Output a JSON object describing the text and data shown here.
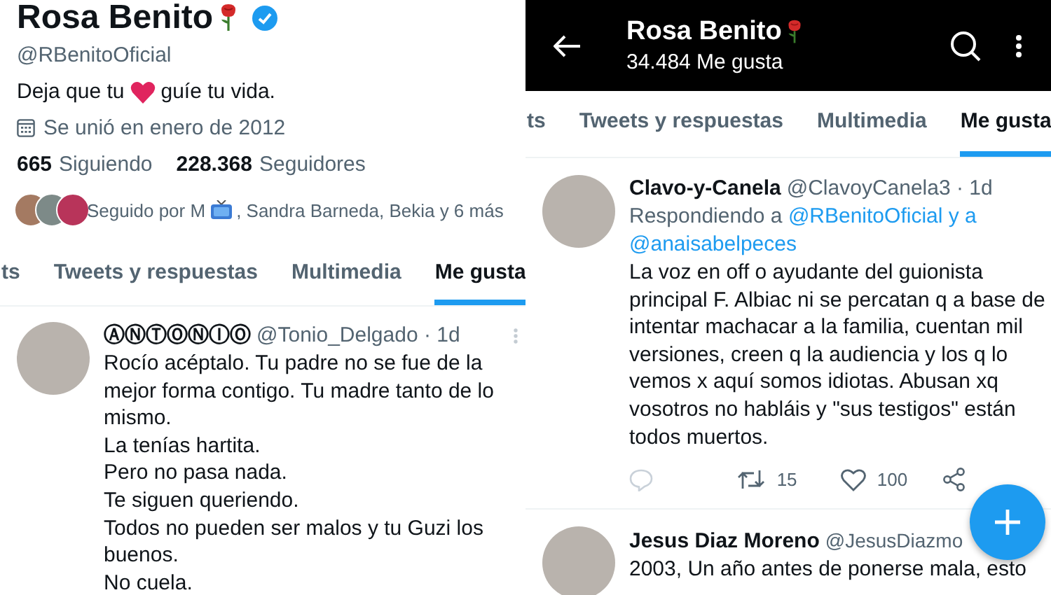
{
  "left_panel": {
    "profile": {
      "name": "Rosa Benito",
      "verified": true,
      "handle": "@RBenitoOficial",
      "bio_before": "Deja que tu",
      "bio_after": "guíe tu vida.",
      "joined": "Se unió en enero de 2012",
      "following_count": "665",
      "following_label": "Siguiendo",
      "followers_count": "228.368",
      "followers_label": "Seguidores",
      "followed_by_before": "Seguido por M",
      "followed_by_after": ", Sandra Barneda, Bekia y 6 más"
    },
    "tabs": [
      {
        "label": "ts",
        "selected": false
      },
      {
        "label": "Tweets y respuestas",
        "selected": false
      },
      {
        "label": "Multimedia",
        "selected": false
      },
      {
        "label": "Me gusta",
        "selected": true
      }
    ],
    "tweets": [
      {
        "author": "ⒶⓃⓉⓄⓃⒾⓄ",
        "meta": "@Tonio_Delgado · 1d",
        "text": "Rocío acéptalo. Tu padre no se fue de la mejor forma contigo. Tu madre tanto de lo mismo.\nLa tenías hartita.\nPero no pasa nada.\nTe siguen queriendo.\nTodos no pueden ser malos y tu Guzi los buenos.\nNo cuela."
      }
    ]
  },
  "right_panel": {
    "header": {
      "title": "Rosa Benito",
      "subtitle": "34.484 Me gusta"
    },
    "tabs": [
      {
        "label": "ts",
        "selected": false
      },
      {
        "label": "Tweets y respuestas",
        "selected": false
      },
      {
        "label": "Multimedia",
        "selected": false
      },
      {
        "label": "Me gusta",
        "selected": true
      }
    ],
    "tweets": [
      {
        "author": "Clavo-y-Canela",
        "meta": "@ClavoyCanela3 · 1d",
        "reply_prefix": "Respondiendo a",
        "reply_to": [
          "@RBenitoOficial y a",
          "@anaisabelpeces"
        ],
        "text": "La voz en off o ayudante del guionista principal F. Albiac ni se percatan q a base de intentar machacar a  la familia, cuentan mil versiones, creen q la audiencia y los q lo vemos x aquí somos idiotas. Abusan xq vosotros no habláis y \"sus testigos\" están todos muertos.",
        "retweets": "15",
        "likes": "100"
      },
      {
        "author": "Jesus Diaz Moreno",
        "meta": "@JesusDiazmo",
        "text": "2003, Un año antes de ponerse mala, esto"
      }
    ]
  }
}
